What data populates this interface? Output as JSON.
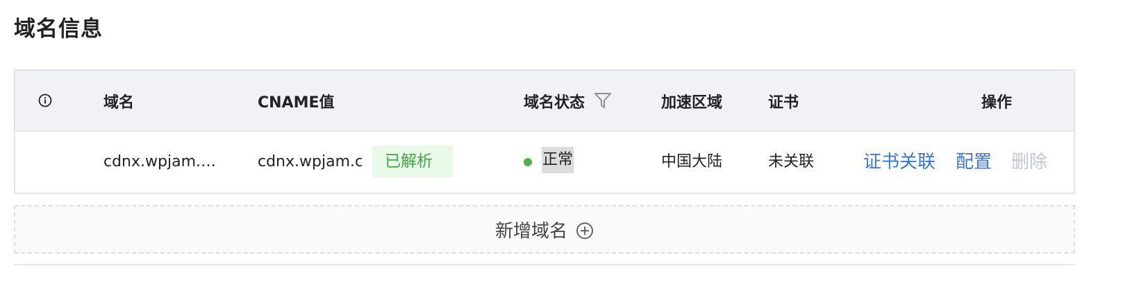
{
  "page": {
    "title": "域名信息"
  },
  "table": {
    "columns": {
      "info": "",
      "domain": "域名",
      "cname": "CNAME值",
      "status": "域名状态",
      "region": "加速区域",
      "cert": "证书",
      "actions": "操作"
    },
    "rows": [
      {
        "domain": "cdnx.wpjam.…",
        "cname": "cdnx.wpjam.co",
        "resolve_tag": "已解析",
        "status": "正常",
        "region": "中国大陆",
        "cert": "未关联",
        "actions": [
          "证书关联",
          "配置",
          "删除"
        ]
      }
    ]
  },
  "add_domain": {
    "label": "新增域名"
  },
  "colors": {
    "link": "#3a78e0",
    "success": "#4fb54a",
    "tag_bg": "#e9fbe8",
    "header_bg": "#f1f2f6",
    "disabled": "#c4c7cf"
  },
  "icons": {
    "info": "info-circle-icon",
    "filter": "filter-icon",
    "add": "plus-circle-icon"
  }
}
